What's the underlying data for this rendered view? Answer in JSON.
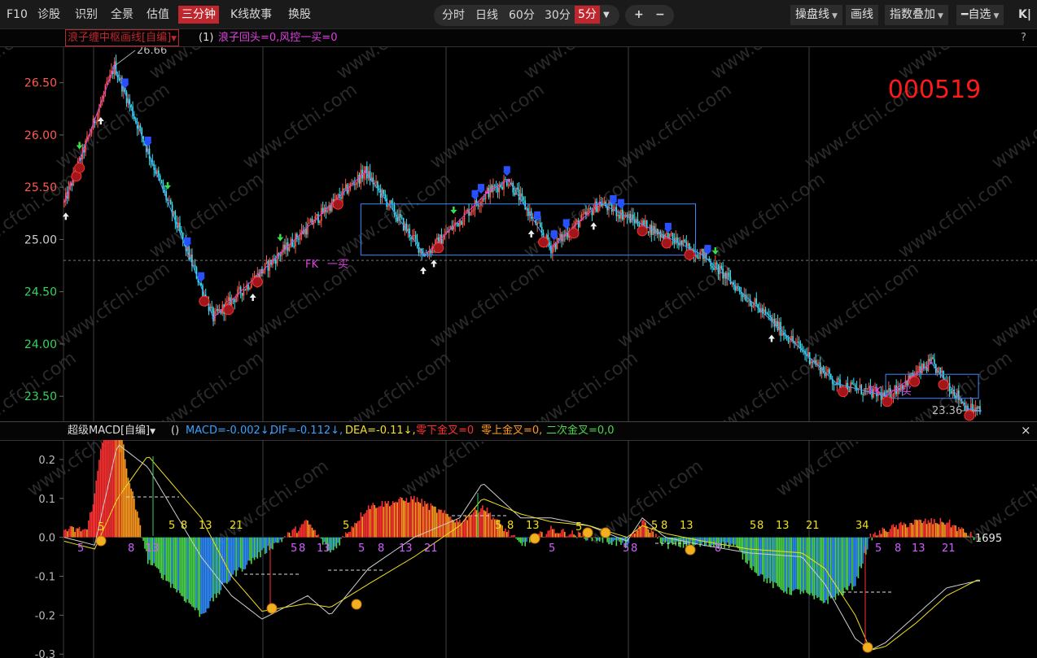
{
  "toolbar": {
    "items": [
      "F10",
      "诊股",
      "识别",
      "全景",
      "估值",
      "三分钟",
      "K线故事",
      "换股"
    ],
    "active_item": "三分钟",
    "periods": [
      "分时",
      "日线",
      "60分",
      "30分",
      "5分"
    ],
    "active_period": "5分",
    "zoom_in": "+",
    "zoom_out": "−",
    "right_buttons": [
      "操盘线",
      "画线",
      "指数叠加",
      "自选"
    ],
    "collapse": "K|"
  },
  "main_panel": {
    "indicator_name": "浪子缠中枢画线[自编]",
    "param": "(1)",
    "values_text": "浪子回头=0,风控一买=0",
    "help": "?",
    "stock_code": "000519",
    "fk_labels": [
      "FK",
      "一买",
      "FK",
      "一买"
    ],
    "watermark": "www.cfchi.com"
  },
  "macd_panel": {
    "indicator_name": "超级MACD[自编]",
    "param": "()",
    "macd_text": "MACD=-0.002↓,",
    "dif_text": "DIF=-0.112↓,",
    "dea_text": "DEA=-0.11↓,",
    "zero_down": "零下金叉=0",
    "zero_up": "零上金叉=0,",
    "second_cross": "二次金叉=0,0",
    "close": "×",
    "last_label": "1695",
    "fib_labels": [
      [
        "5",
        120,
        652
      ],
      [
        "5",
        95,
        678
      ],
      [
        "8",
        157,
        678
      ],
      [
        "13",
        179,
        678
      ],
      [
        "5",
        207,
        650
      ],
      [
        "8",
        222,
        650
      ],
      [
        "13",
        244,
        650
      ],
      [
        "21",
        282,
        650
      ],
      [
        "5",
        357,
        678
      ],
      [
        "8",
        367,
        678
      ],
      [
        "13",
        389,
        678
      ],
      [
        "5",
        421,
        650
      ],
      [
        "5",
        440,
        678
      ],
      [
        "8",
        464,
        678
      ],
      [
        "13",
        490,
        678
      ],
      [
        "21",
        521,
        678
      ],
      [
        "5",
        608,
        650
      ],
      [
        "8",
        623,
        650
      ],
      [
        "13",
        646,
        650
      ],
      [
        "5",
        674,
        678
      ],
      [
        "5",
        707,
        652
      ],
      [
        "5",
        765,
        678
      ],
      [
        "8",
        775,
        678
      ],
      [
        "5",
        800,
        650
      ],
      [
        "8",
        812,
        650
      ],
      [
        "13",
        835,
        650
      ],
      [
        "8",
        878,
        678
      ],
      [
        "5",
        921,
        650
      ],
      [
        "8",
        930,
        650
      ],
      [
        "13",
        953,
        650
      ],
      [
        "21",
        990,
        650
      ],
      [
        "34",
        1051,
        650
      ],
      [
        "5",
        1075,
        678
      ],
      [
        "8",
        1099,
        678
      ],
      [
        "13",
        1120,
        678
      ],
      [
        "21",
        1157,
        678
      ]
    ]
  },
  "chart_data": [
    {
      "type": "candlestick",
      "y_ticks": [
        26.5,
        26.0,
        25.5,
        25.0,
        24.5,
        24.0,
        23.5
      ],
      "ylim": [
        23.26,
        26.84
      ],
      "x_range": [
        0,
        240
      ],
      "last_price_line": 24.8,
      "high_label": "26.66",
      "low_label": "23.36",
      "zigzag_pivots": [
        [
          0,
          25.35
        ],
        [
          33,
          26.66
        ],
        [
          98,
          24.25
        ],
        [
          198,
          25.65
        ],
        [
          237,
          24.85
        ],
        [
          278,
          25.45
        ],
        [
          292,
          25.57
        ],
        [
          320,
          24.92
        ],
        [
          352,
          25.35
        ],
        [
          420,
          24.85
        ],
        [
          508,
          23.62
        ],
        [
          540,
          23.5
        ],
        [
          570,
          23.82
        ],
        [
          594,
          23.38
        ],
        [
          602,
          23.36
        ]
      ],
      "zhongshu_boxes": [
        {
          "x0": 195,
          "x1": 415,
          "y_top": 25.34,
          "y_bottom": 24.85
        },
        {
          "x0": 540,
          "x1": 601,
          "y_top": 23.71,
          "y_bottom": 23.48
        }
      ]
    },
    {
      "type": "macd",
      "y_ticks": [
        0.2,
        0.1,
        0.0,
        -0.1,
        -0.2,
        -0.3
      ],
      "ylim": [
        -0.31,
        0.25
      ],
      "macd_last": -0.002,
      "dif_last": -0.112,
      "dea_last": -0.11,
      "dif_keypoints": [
        [
          0,
          0.0
        ],
        [
          20,
          -0.02
        ],
        [
          35,
          0.24
        ],
        [
          55,
          0.18
        ],
        [
          90,
          -0.05
        ],
        [
          110,
          -0.15
        ],
        [
          130,
          -0.21
        ],
        [
          160,
          -0.15
        ],
        [
          175,
          -0.2
        ],
        [
          200,
          -0.08
        ],
        [
          230,
          0.0
        ],
        [
          260,
          0.05
        ],
        [
          275,
          0.14
        ],
        [
          300,
          0.05
        ],
        [
          320,
          0.05
        ],
        [
          345,
          0.03
        ],
        [
          370,
          -0.01
        ],
        [
          380,
          0.05
        ],
        [
          395,
          0.0
        ],
        [
          420,
          -0.02
        ],
        [
          450,
          -0.04
        ],
        [
          485,
          -0.05
        ],
        [
          500,
          -0.12
        ],
        [
          520,
          -0.26
        ],
        [
          530,
          -0.29
        ],
        [
          540,
          -0.27
        ],
        [
          560,
          -0.2
        ],
        [
          580,
          -0.13
        ],
        [
          600,
          -0.112
        ]
      ],
      "dea_keypoints": [
        [
          0,
          -0.01
        ],
        [
          20,
          -0.03
        ],
        [
          35,
          0.1
        ],
        [
          55,
          0.21
        ],
        [
          90,
          0.05
        ],
        [
          110,
          -0.1
        ],
        [
          130,
          -0.19
        ],
        [
          160,
          -0.17
        ],
        [
          175,
          -0.18
        ],
        [
          200,
          -0.12
        ],
        [
          230,
          -0.05
        ],
        [
          260,
          0.03
        ],
        [
          275,
          0.1
        ],
        [
          300,
          0.06
        ],
        [
          320,
          0.04
        ],
        [
          345,
          0.03
        ],
        [
          370,
          0.0
        ],
        [
          380,
          0.03
        ],
        [
          395,
          0.01
        ],
        [
          420,
          -0.01
        ],
        [
          450,
          -0.03
        ],
        [
          485,
          -0.04
        ],
        [
          500,
          -0.08
        ],
        [
          520,
          -0.2
        ],
        [
          530,
          -0.29
        ],
        [
          540,
          -0.28
        ],
        [
          560,
          -0.22
        ],
        [
          580,
          -0.15
        ],
        [
          600,
          -0.11
        ]
      ]
    }
  ],
  "colors": {
    "up": "#ff5a4d",
    "down": "#35e6f0",
    "zigzag_down": "#4a9dff",
    "zigzag_up": "#e040e0",
    "box": "#3b8cff",
    "dif": "#cfcfcf",
    "dea": "#f0e020",
    "hist_red": "#ff3030",
    "hist_orange": "#ff9a1e",
    "hist_green": "#4cd84c",
    "hist_blue": "#2f8cff"
  }
}
